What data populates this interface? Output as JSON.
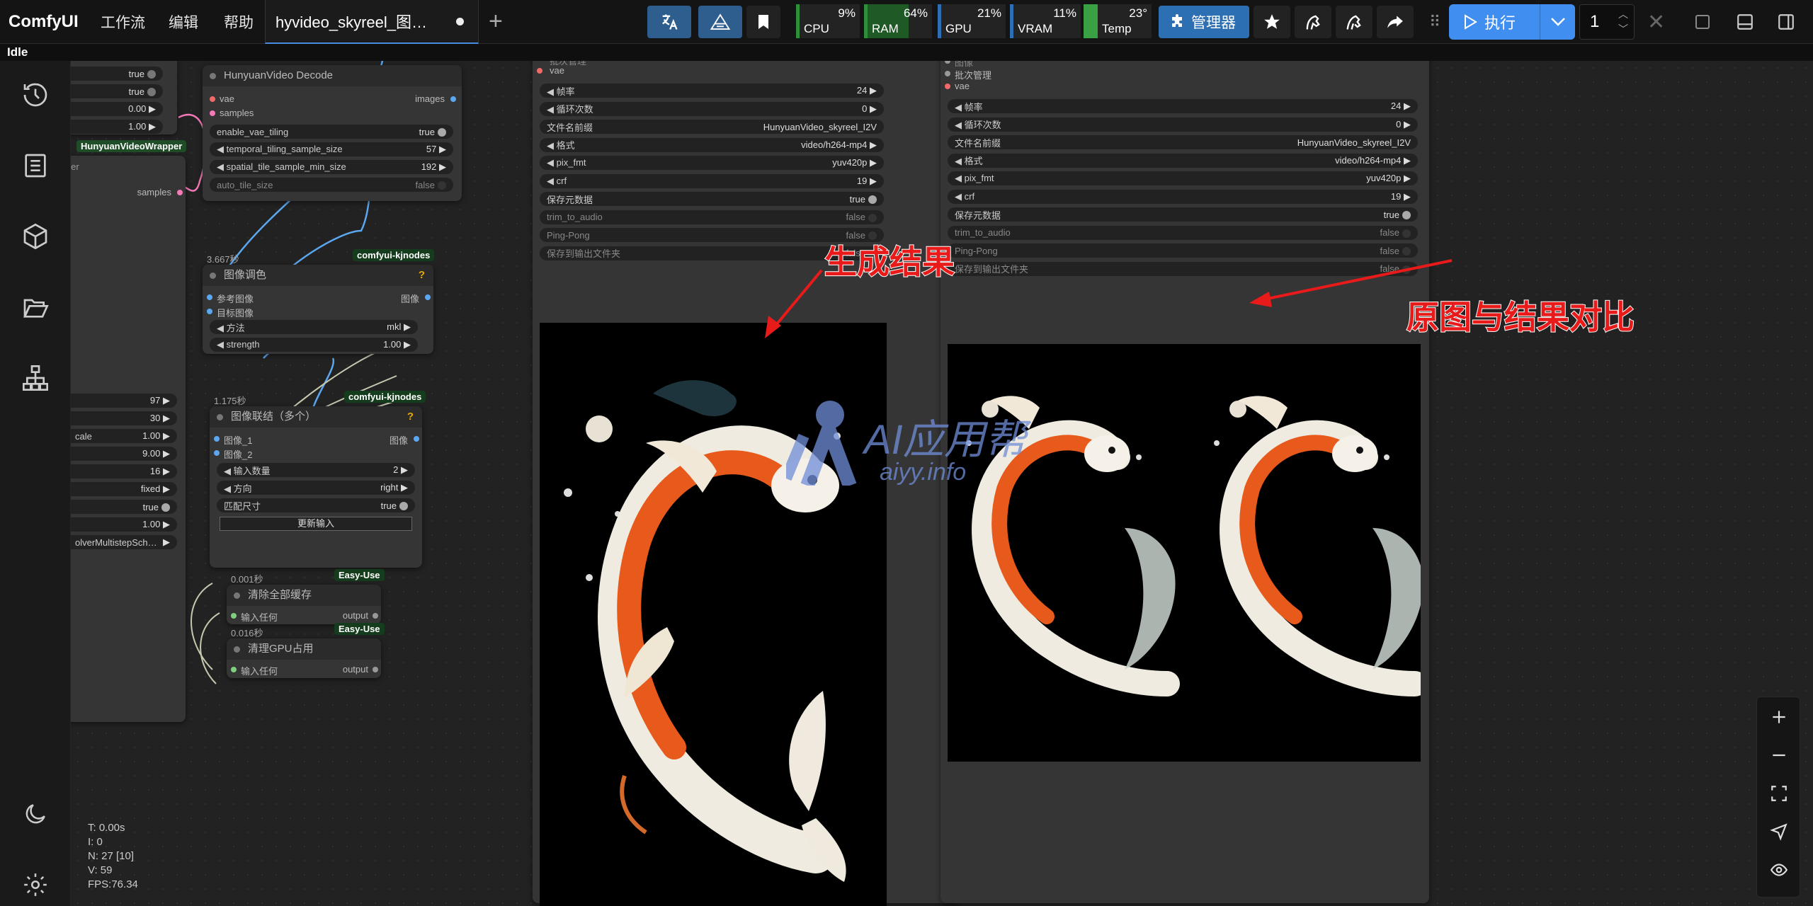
{
  "topbar": {
    "logo": "ComfyUI",
    "menu": [
      "工作流",
      "编辑",
      "帮助"
    ],
    "tab_title": "hyvideo_skyreel_图…",
    "monitors": [
      {
        "label": "CPU",
        "value": "9%",
        "fill": 9,
        "color": "#2e8f3a"
      },
      {
        "label": "RAM",
        "value": "64%",
        "fill": 64,
        "color": "#2e8f3a"
      },
      {
        "label": "GPU",
        "value": "21%",
        "fill": 21,
        "color": "#2e6fb3"
      },
      {
        "label": "VRAM",
        "value": "11%",
        "fill": 11,
        "color": "#2e6fb3"
      },
      {
        "label": "Temp",
        "value": "23°",
        "fill": 23,
        "color": "#2e8f3a"
      }
    ],
    "manager_label": "管理器",
    "run_label": "执行",
    "queue_count": "1"
  },
  "status": "Idle",
  "left_widgets": [
    "true",
    "true",
    "0.00",
    "1.00"
  ],
  "left_node_label": "HunyuanVideoWrapper",
  "left_partial": {
    "title": "oler",
    "output": "samples"
  },
  "left2_widgets": [
    {
      "k": "",
      "v": "97"
    },
    {
      "k": "",
      "v": "30"
    },
    {
      "k": "cale",
      "v": "1.00"
    },
    {
      "k": "",
      "v": "9.00"
    },
    {
      "k": "",
      "v": "16"
    },
    {
      "k": "",
      "v": "fixed"
    },
    {
      "k": "",
      "v": "true"
    },
    {
      "k": "",
      "v": "1.00"
    },
    {
      "k": "olverMultistepSch…",
      "v": ""
    }
  ],
  "decode": {
    "title": "HunyuanVideo Decode",
    "in1": "vae",
    "in2": "samples",
    "out1": "images",
    "widgets": [
      {
        "k": "enable_vae_tiling",
        "v": "true"
      },
      {
        "k": "temporal_tiling_sample_size",
        "v": "57"
      },
      {
        "k": "spatial_tile_sample_min_size",
        "v": "192"
      },
      {
        "k": "auto_tile_size",
        "v": "false"
      }
    ]
  },
  "color": {
    "time": "3.667秒",
    "pack": "comfyui-kjnodes",
    "title": "图像调色",
    "in1": "参考图像",
    "in2": "目标图像",
    "out1": "图像",
    "widgets": [
      {
        "k": "方法",
        "v": "mkl"
      },
      {
        "k": "strength",
        "v": "1.00"
      }
    ]
  },
  "concat": {
    "time": "1.175秒",
    "pack": "comfyui-kjnodes",
    "title": "图像联结（多个）",
    "in1": "图像_1",
    "in2": "图像_2",
    "out1": "图像",
    "widgets": [
      {
        "k": "输入数量",
        "v": "2"
      },
      {
        "k": "方向",
        "v": "right"
      },
      {
        "k": "匹配尺寸",
        "v": "true"
      }
    ],
    "button": "更新输入"
  },
  "clear_cache": {
    "time": "0.001秒",
    "pack": "Easy-Use",
    "title": "清除全部缓存",
    "in": "输入任何",
    "out": "output"
  },
  "clear_gpu": {
    "time": "0.016秒",
    "pack": "Easy-Use",
    "title": "清理GPU占用",
    "in": "输入任何",
    "out": "output"
  },
  "video1": {
    "top": "批次管理",
    "vae": "vae",
    "widgets": [
      {
        "k": "帧率",
        "v": "24"
      },
      {
        "k": "循环次数",
        "v": "0"
      },
      {
        "k": "文件名前缀",
        "v": "HunyuanVideo_skyreel_I2V"
      },
      {
        "k": "格式",
        "v": "video/h264-mp4"
      },
      {
        "k": "pix_fmt",
        "v": "yuv420p"
      },
      {
        "k": "crf",
        "v": "19"
      },
      {
        "k": "保存元数据",
        "v": "true"
      },
      {
        "k": "trim_to_audio",
        "v": "false"
      },
      {
        "k": "Ping-Pong",
        "v": "false"
      },
      {
        "k": "保存到输出文件夹",
        "v": "false"
      }
    ]
  },
  "video2": {
    "top1": "图像",
    "top2": "批次管理",
    "vae": "vae",
    "widgets": [
      {
        "k": "帧率",
        "v": "24"
      },
      {
        "k": "循环次数",
        "v": "0"
      },
      {
        "k": "文件名前缀",
        "v": "HunyuanVideo_skyreel_I2V"
      },
      {
        "k": "格式",
        "v": "video/h264-mp4"
      },
      {
        "k": "pix_fmt",
        "v": "yuv420p"
      },
      {
        "k": "crf",
        "v": "19"
      },
      {
        "k": "保存元数据",
        "v": "true"
      },
      {
        "k": "trim_to_audio",
        "v": "false"
      },
      {
        "k": "Ping-Pong",
        "v": "false"
      },
      {
        "k": "保存到输出文件夹",
        "v": "false"
      }
    ]
  },
  "annotations": {
    "a1": "生成结果",
    "a2": "原图与结果对比"
  },
  "watermark": {
    "t1": "AI应用帮",
    "t2": "aiyy.info"
  },
  "stats": [
    "T: 0.00s",
    "I: 0",
    "N: 27 [10]",
    "V: 59",
    "FPS:76.34"
  ]
}
